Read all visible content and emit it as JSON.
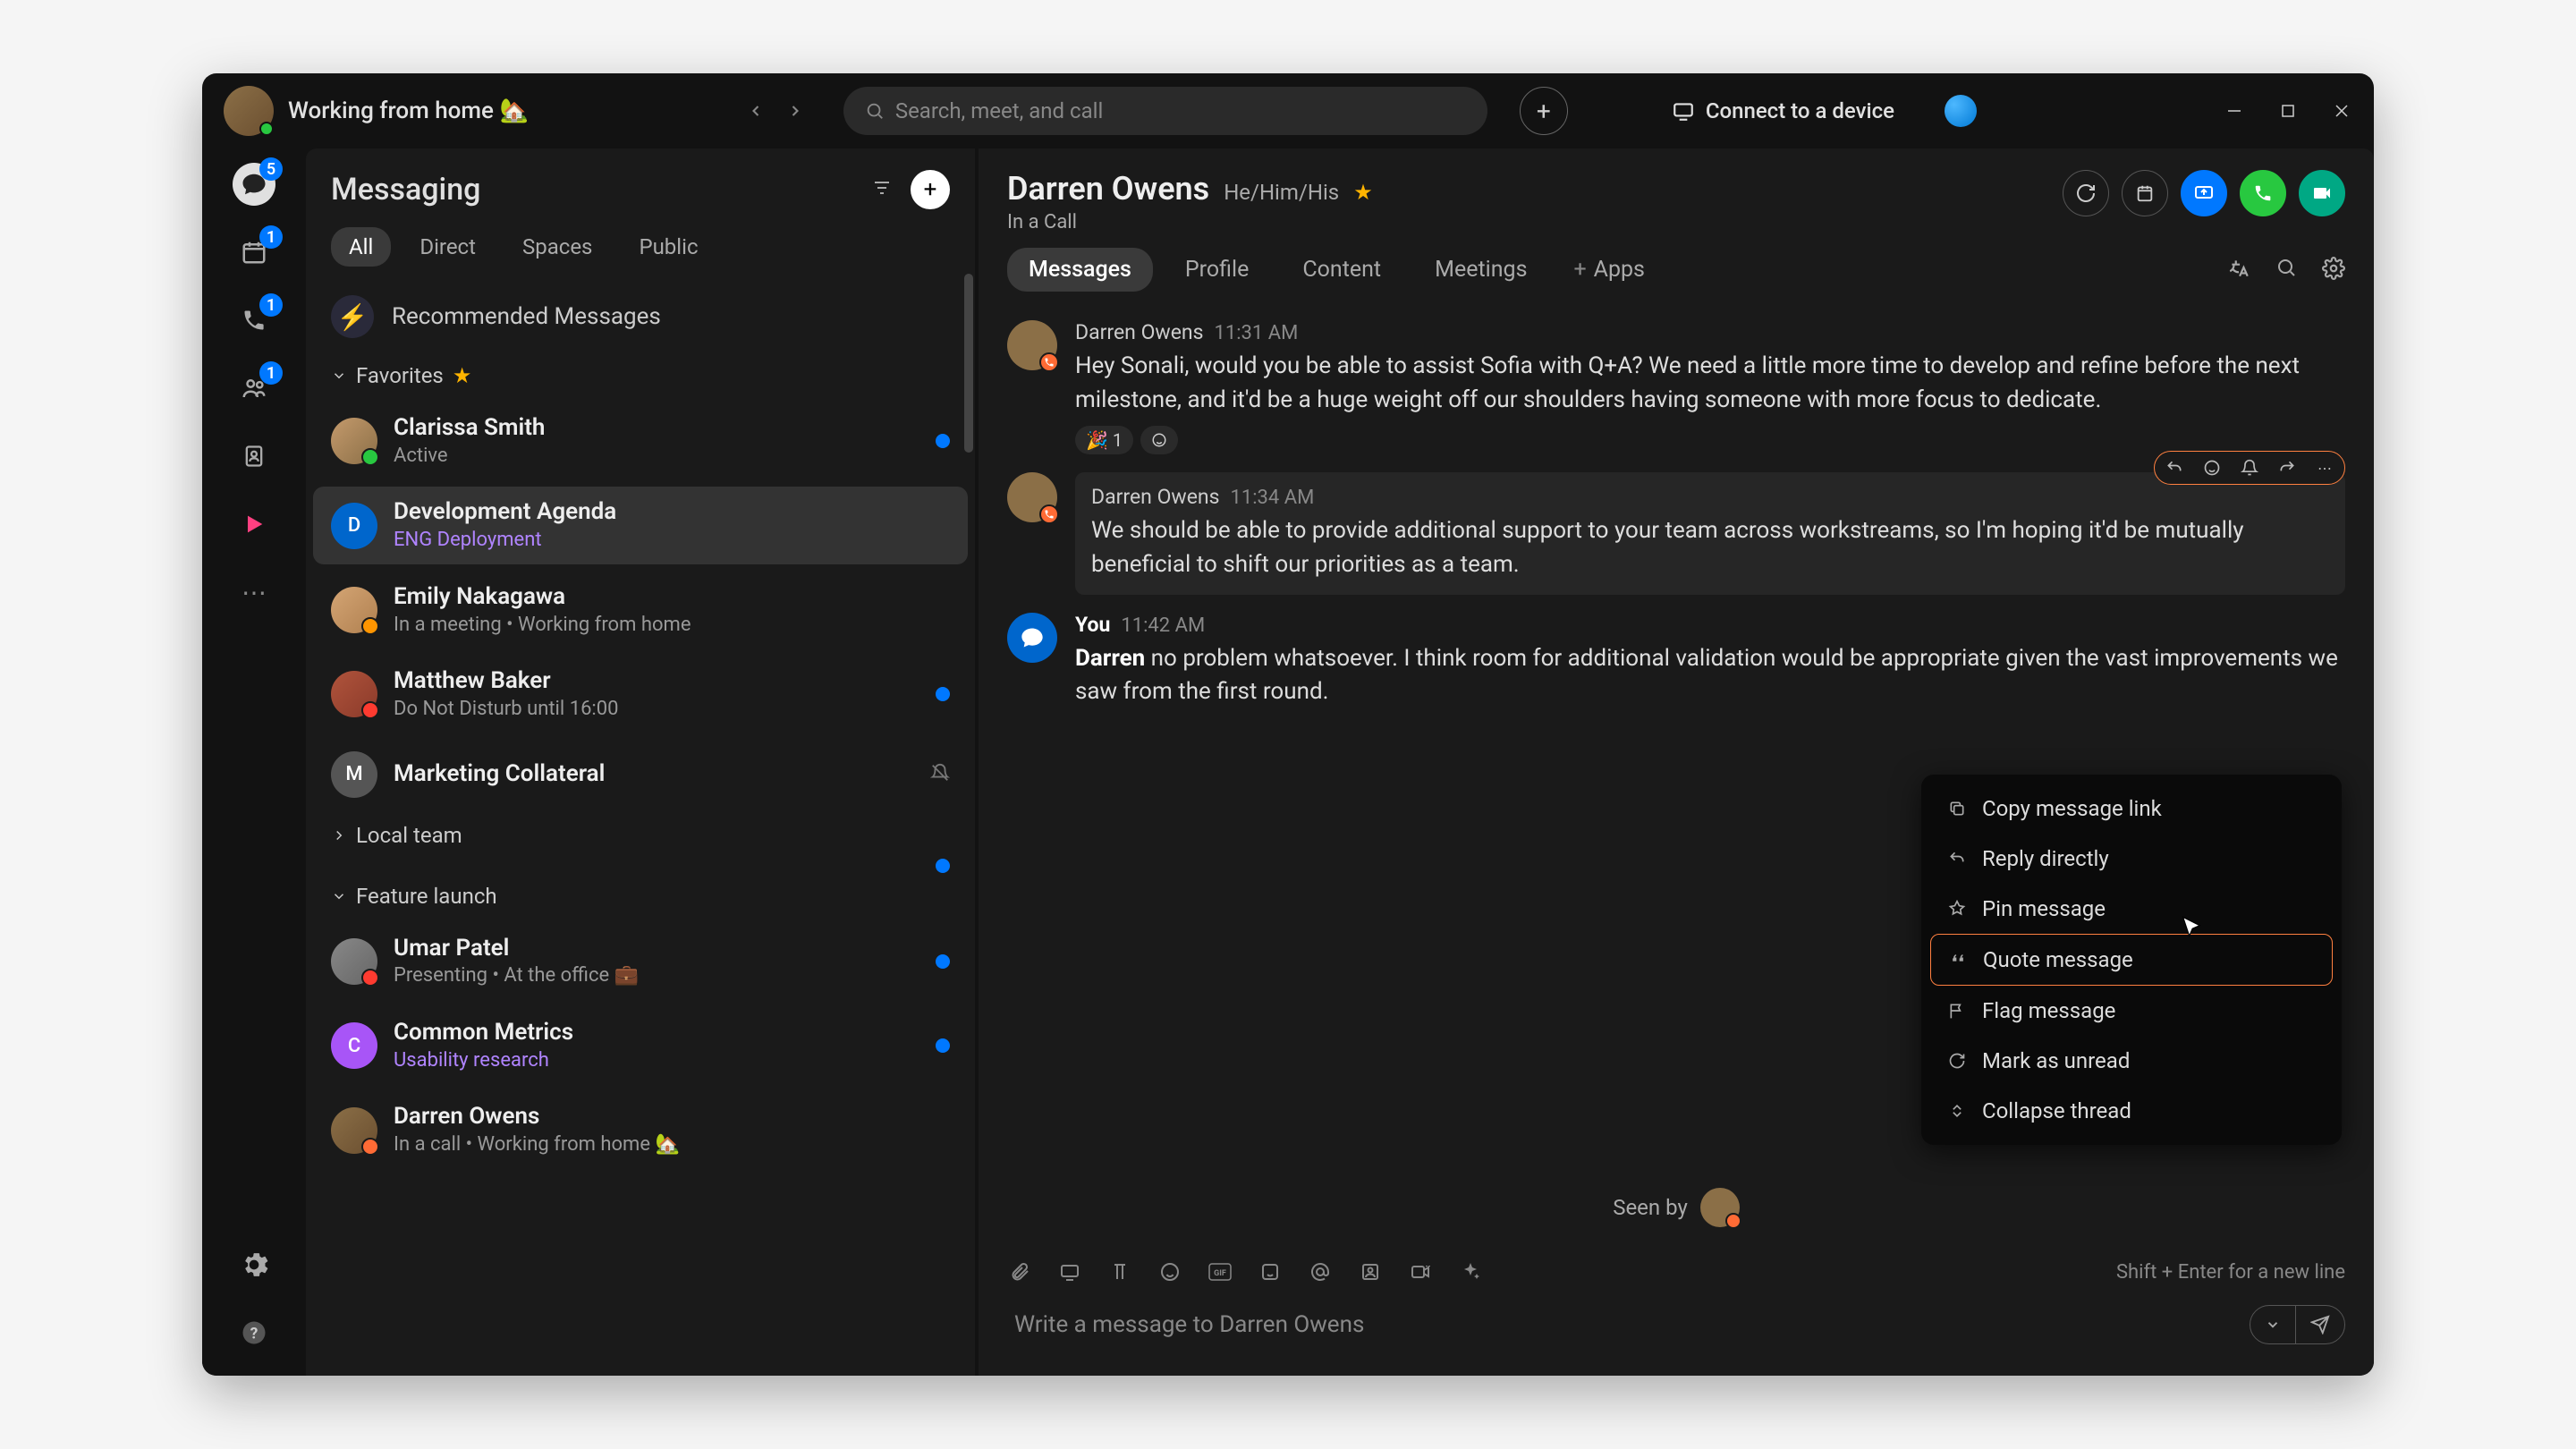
{
  "titlebar": {
    "status": "Working from home 🏡",
    "search_placeholder": "Search, meet, and call",
    "connect": "Connect to a device"
  },
  "rail": {
    "chat_badge": "5",
    "calendar_badge": "1",
    "call_badge": "1",
    "teams_badge": "1"
  },
  "sidebar": {
    "title": "Messaging",
    "tabs": {
      "all": "All",
      "direct": "Direct",
      "spaces": "Spaces",
      "public": "Public"
    },
    "recommended": "Recommended Messages",
    "favorites_label": "Favorites",
    "local_team_label": "Local team",
    "feature_launch_label": "Feature launch",
    "items": {
      "clarissa": {
        "name": "Clarissa Smith",
        "sub": "Active"
      },
      "dev": {
        "name": "Development Agenda",
        "sub": "ENG Deployment"
      },
      "emily": {
        "name": "Emily Nakagawa",
        "sub": "In a meeting  •  Working from home"
      },
      "matthew": {
        "name": "Matthew Baker",
        "sub": "Do Not Disturb until 16:00"
      },
      "marketing": {
        "name": "Marketing Collateral"
      },
      "umar": {
        "name": "Umar Patel",
        "sub": "Presenting  •  At the office 💼"
      },
      "common": {
        "name": "Common Metrics",
        "sub": "Usability research"
      },
      "darren": {
        "name": "Darren Owens",
        "sub": "In a call  •  Working from home 🏡"
      }
    }
  },
  "chat": {
    "name": "Darren Owens",
    "pronouns": "He/Him/His",
    "sub": "In a Call",
    "tabs": {
      "messages": "Messages",
      "profile": "Profile",
      "content": "Content",
      "meetings": "Meetings",
      "apps": "Apps"
    },
    "messages": [
      {
        "author": "Darren Owens",
        "time": "11:31 AM",
        "text": "Hey Sonali, would you be able to assist Sofia with Q+A? We need a little more time to develop and refine before the next milestone, and it'd be a huge weight off our shoulders having someone with more focus to dedicate.",
        "reaction": "🎉 1"
      },
      {
        "author": "Darren Owens",
        "time": "11:34 AM",
        "text": "We should be able to provide additional support to your team across workstreams, so I'm hoping it'd be mutually beneficial to shift our priorities as a team."
      },
      {
        "author": "You",
        "time": "11:42 AM",
        "bold": "Darren",
        "text": " no problem whatsoever. I think room for additional validation would be appropriate given the vast improvements we saw from the first round."
      }
    ],
    "seen_by": "Seen by",
    "composer": {
      "hint": "Shift + Enter for a new line",
      "placeholder": "Write a message to Darren Owens"
    },
    "context_menu": {
      "copy": "Copy message link",
      "reply": "Reply directly",
      "pin": "Pin message",
      "quote": "Quote message",
      "flag": "Flag message",
      "unread": "Mark as unread",
      "collapse": "Collapse thread"
    }
  }
}
